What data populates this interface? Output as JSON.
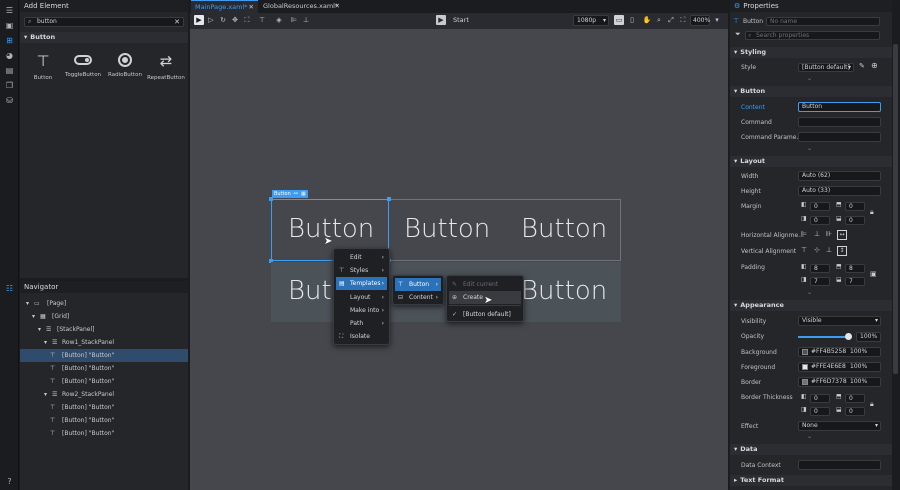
{
  "add_element": {
    "title": "Add Element",
    "search_value": "button",
    "category": "Button",
    "items": [
      {
        "label": "Button",
        "icon": "button-icon"
      },
      {
        "label": "ToggleButton",
        "icon": "toggle-icon"
      },
      {
        "label": "RadioButton",
        "icon": "radio-icon"
      },
      {
        "label": "RepeatButton",
        "icon": "repeat-button-icon"
      }
    ]
  },
  "tabs": [
    {
      "label": "MainPage.xaml*",
      "active": true
    },
    {
      "label": "GlobalResources.xaml*",
      "active": false
    }
  ],
  "toolbar": {
    "start_label": "Start",
    "resolution": "1080p",
    "zoom": "400%"
  },
  "canvas": {
    "selection_tag": "Button",
    "row1": [
      "Button",
      "Button",
      "Button"
    ],
    "row2": [
      "Butt",
      "Button"
    ]
  },
  "context_menu": {
    "main": [
      {
        "label": "Edit",
        "icon": "",
        "submenu": true
      },
      {
        "label": "Styles",
        "icon": "brush-icon",
        "submenu": true
      },
      {
        "label": "Templates",
        "icon": "template-icon",
        "submenu": true,
        "highlight": true
      },
      {
        "label": "Layout",
        "icon": "",
        "submenu": true
      },
      {
        "label": "Make into",
        "icon": "",
        "submenu": true
      },
      {
        "label": "Path",
        "icon": "",
        "submenu": true
      },
      {
        "label": "Isolate",
        "icon": "isolate-icon",
        "submenu": false
      }
    ],
    "templates": [
      {
        "label": "Button",
        "icon": "button-icon",
        "highlight": true
      },
      {
        "label": "Content",
        "icon": "content-icon",
        "highlight": false
      }
    ],
    "button_sub": [
      {
        "label": "Edit current",
        "disabled": true
      },
      {
        "label": "Create",
        "hover": true
      },
      {
        "label": "[Button default]",
        "checked": true
      }
    ]
  },
  "navigator": {
    "title": "Navigator",
    "rows": [
      {
        "label": "[Page]",
        "depth": 0
      },
      {
        "label": "[Grid]",
        "depth": 1
      },
      {
        "label": "[StackPanel]",
        "depth": 2
      },
      {
        "label": "Row1_StackPanel",
        "depth": 3
      },
      {
        "label": "[Button] \"Button\"",
        "depth": 4,
        "selected": true
      },
      {
        "label": "[Button] \"Button\"",
        "depth": 4
      },
      {
        "label": "[Button] \"Button\"",
        "depth": 4
      },
      {
        "label": "Row2_StackPanel",
        "depth": 3
      },
      {
        "label": "[Button] \"Button\"",
        "depth": 4
      },
      {
        "label": "[Button] \"Button\"",
        "depth": 4
      },
      {
        "label": "[Button] \"Button\"",
        "depth": 4
      }
    ]
  },
  "properties": {
    "title": "Properties",
    "element_type": "Button",
    "name_placeholder": "No name",
    "search_placeholder": "Search properties",
    "styling": {
      "header": "Styling",
      "style_label": "Style",
      "style_value": "[Button default]"
    },
    "button": {
      "header": "Button",
      "content_label": "Content",
      "content_value": "Button",
      "command_label": "Command",
      "command_param_label": "Command Parame..."
    },
    "layout": {
      "header": "Layout",
      "width_label": "Width",
      "width_value": "Auto (62)",
      "height_label": "Height",
      "height_value": "Auto (33)",
      "margin_label": "Margin",
      "margin_values": [
        "0",
        "0",
        "0",
        "0"
      ],
      "halign_label": "Horizontal Alignme...",
      "valign_label": "Vertical Alignment",
      "padding_label": "Padding",
      "padding_values": [
        "8",
        "8",
        "7",
        "7"
      ]
    },
    "appearance": {
      "header": "Appearance",
      "visibility_label": "Visibility",
      "visibility_value": "Visible",
      "opacity_label": "Opacity",
      "opacity_value": "100%",
      "background_label": "Background",
      "background_value": "#FF4B5258",
      "background_pct": "100%",
      "background_color": "#4B5258",
      "foreground_label": "Foreground",
      "foreground_value": "#FFE4E6E8",
      "foreground_pct": "100%",
      "foreground_color": "#E4E6E8",
      "border_label": "Border",
      "border_value": "#FF6D7378",
      "border_pct": "100%",
      "border_color": "#6D7378",
      "border_thickness_label": "Border Thickness",
      "border_thickness_values": [
        "0",
        "0",
        "0",
        "0"
      ],
      "effect_label": "Effect",
      "effect_value": "None"
    },
    "data": {
      "header": "Data",
      "datacontext_label": "Data Context"
    },
    "textformat": {
      "header": "Text Format"
    }
  },
  "colors": {
    "accent": "#3d9df3",
    "canvas_bg": "#45474d",
    "menu_highlight": "#2b72b8"
  }
}
